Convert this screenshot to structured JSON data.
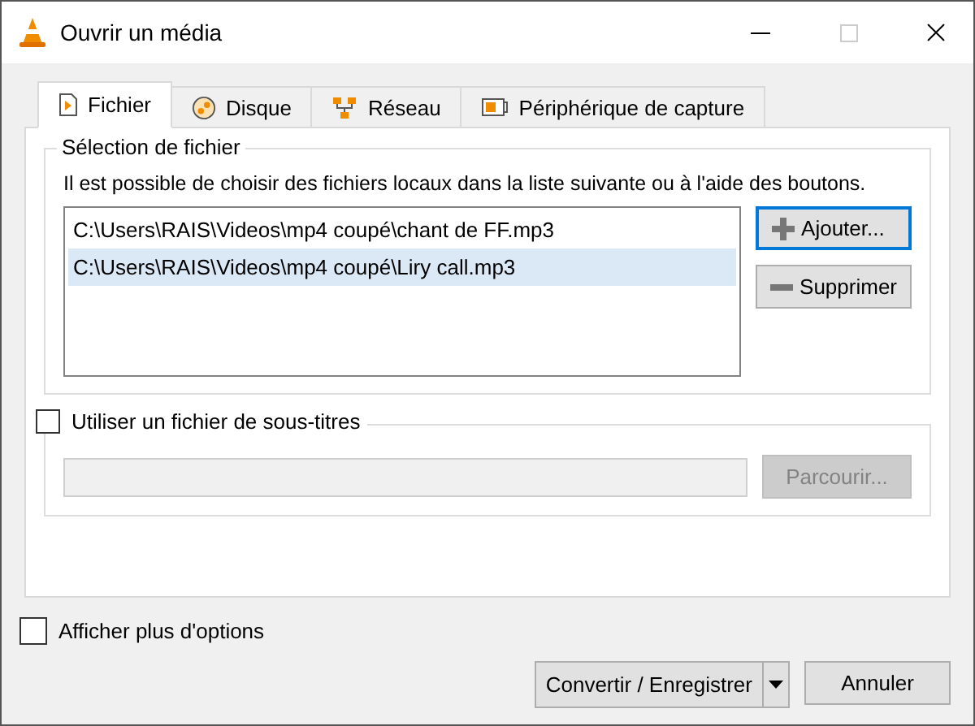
{
  "window": {
    "title": "Ouvrir un média"
  },
  "tabs": [
    {
      "label": "Fichier",
      "kind": "file",
      "selected": true
    },
    {
      "label": "Disque",
      "kind": "disc",
      "selected": false
    },
    {
      "label": "Réseau",
      "kind": "network",
      "selected": false
    },
    {
      "label": "Périphérique de capture",
      "kind": "capture",
      "selected": false
    }
  ],
  "file_selection": {
    "title": "Sélection de fichier",
    "description": "Il est possible de choisir des fichiers locaux dans la liste suivante ou à l'aide des boutons.",
    "files": [
      {
        "path": "C:\\Users\\RAIS\\Videos\\mp4 coupé\\chant de FF.mp3",
        "selected": false
      },
      {
        "path": "C:\\Users\\RAIS\\Videos\\mp4 coupé\\Liry call.mp3",
        "selected": true
      }
    ],
    "add_button": "Ajouter...",
    "remove_button": "Supprimer"
  },
  "subtitles": {
    "label": "Utiliser un fichier de sous-titres",
    "checked": false,
    "browse_button": "Parcourir...",
    "disabled": true
  },
  "more_options": {
    "label": "Afficher plus d'options",
    "checked": false
  },
  "buttons": {
    "convert": "Convertir / Enregistrer",
    "cancel": "Annuler"
  }
}
